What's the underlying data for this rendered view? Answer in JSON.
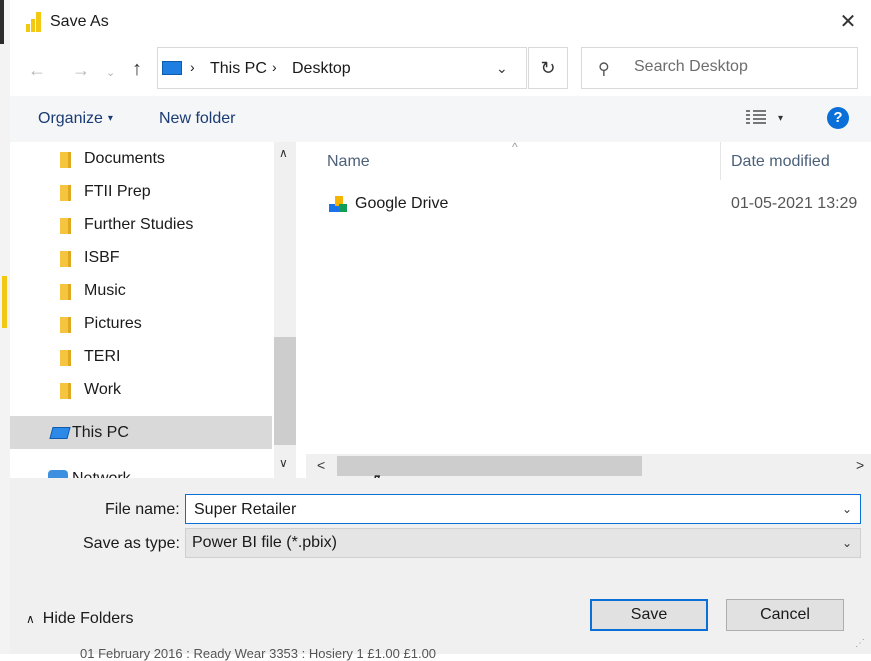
{
  "window": {
    "title": "Save As",
    "close_glyph": "✕"
  },
  "nav": {
    "back_glyph": "←",
    "forward_glyph": "→",
    "recent_glyph": "⌄",
    "up_glyph": "↑",
    "breadcrumb": [
      "This PC",
      "Desktop"
    ],
    "separator_glyph": "›",
    "dropdown_glyph": "⌄",
    "refresh_glyph": "↻"
  },
  "search": {
    "placeholder": "Search Desktop",
    "icon_glyph": "⚲"
  },
  "toolbar": {
    "organize_label": "Organize",
    "organize_caret": "▾",
    "new_folder_label": "New folder",
    "view_caret": "▾",
    "help_label": "?"
  },
  "navpane": {
    "items": [
      {
        "label": "Documents"
      },
      {
        "label": "FTII Prep"
      },
      {
        "label": "Further Studies"
      },
      {
        "label": "ISBF"
      },
      {
        "label": "Music"
      },
      {
        "label": "Pictures"
      },
      {
        "label": "TERI"
      },
      {
        "label": "Work"
      },
      {
        "label": "This PC",
        "selected": true
      },
      {
        "label": "Network"
      }
    ],
    "scroll_up": "∧",
    "scroll_down": "∨"
  },
  "filelist": {
    "sort_glyph": "^",
    "columns": {
      "name": "Name",
      "date": "Date modified"
    },
    "rows": [
      {
        "name": "Google Drive",
        "date": "01-05-2021 13:29"
      }
    ],
    "scroll_left": "<",
    "scroll_right": ">"
  },
  "form": {
    "file_name_label": "File name:",
    "file_name_value": "Super Retailer",
    "save_type_label": "Save as type:",
    "save_type_value": "Power BI file (*.pbix)",
    "dropdown_glyph": "⌄"
  },
  "footer": {
    "hide_folders_chevron": "∧",
    "hide_folders_label": "Hide Folders",
    "save_label": "Save",
    "cancel_label": "Cancel",
    "grip_glyph": "⋰"
  },
  "background_text": "01 February 2016 : Ready Wear          3353 : Hosiery          1          £1.00          £1.00",
  "colors": {
    "accent": "#0a6fd8",
    "powerbi": "#f2c811",
    "folder": "#f5c542",
    "toolbar_bg": "#f5f6f7",
    "footer_bg": "#f0f0f0"
  },
  "mouse_cursor_glyph": "⇖"
}
